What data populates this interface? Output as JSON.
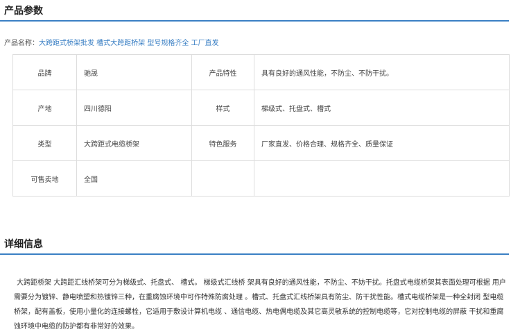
{
  "sections": {
    "params_title": "产品参数",
    "detail_title": "详细信息"
  },
  "product_name": {
    "label": "产品名称：",
    "value": "大跨距式桥架批发 槽式大跨距桥架 型号规格齐全 工厂直发"
  },
  "params": [
    [
      "品牌",
      "驰晟",
      "产品特性",
      "具有良好的通风性能，不防尘、不防干扰。"
    ],
    [
      "产地",
      "四川德阳",
      "样式",
      "梯级式、托盘式、槽式"
    ],
    [
      "类型",
      "大跨距式电缆桥架",
      "特色服务",
      "厂家直发、价格合理、规格齐全、质量保证"
    ],
    [
      "可售卖地",
      "全国",
      "",
      ""
    ]
  ],
  "detail_text": "大跨距桥架 大跨距汇线桥架可分为梯级式、托盘式、 槽式。 梯级式汇线桥 架具有良好的通风性能，不防尘、不妨干扰。托盘式电缆桥架其表面处理可根据 用户需要分为镀锌、静电喷塑和热镀锌三种，在重腐蚀环境中可作特殊防腐处理 。槽式、托盘式汇线桥架具有防尘、防干扰性能。槽式电缆桥架是一种全封闭 型电缆桥架，配有盖板，使用小量化的连接螺栓，它适用于敷设计算机电缆 、通信电缆、热电偶电缆及其它高灵敏系统的控制电缆等，它对控制电缆的屏蔽 干扰和重腐蚀环境中电缆的防护都有非常好的效果。"
}
